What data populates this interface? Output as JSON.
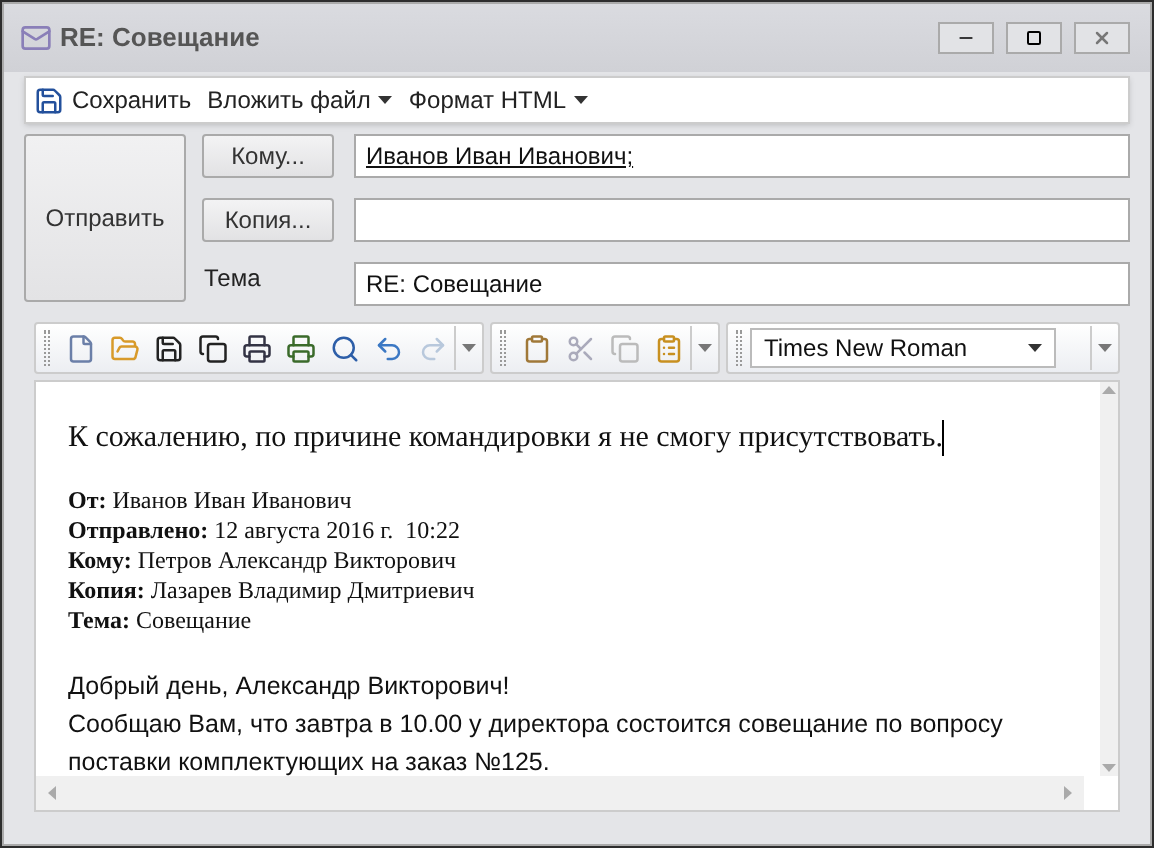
{
  "window": {
    "title": "RE: Совещание"
  },
  "menu": [
    {
      "label": "Сохранить",
      "kind": "save"
    },
    {
      "label": "Вложить файл",
      "kind": "dropdown"
    },
    {
      "label": "Формат HTML",
      "kind": "dropdown"
    }
  ],
  "send_button": "Отправить",
  "fields": [
    {
      "kind": "button",
      "label": "Кому...",
      "value": "Иванов Иван Иванович;"
    },
    {
      "kind": "button",
      "label": "Копия..."
    },
    {
      "kind": "label",
      "label": "Тема",
      "value": "RE: Совещание"
    }
  ],
  "font_select": {
    "value": "Times New Roman"
  },
  "editor": {
    "reply": "К сожалению, по причине командировки я не смогу присутствовать.",
    "quote_header": [
      "**От:** Иванов Иван Иванович",
      "**Отправлено:** 12 августа 2016 г.  10:22",
      "**Кому:** Петров Александр Викторович",
      "**Копия:** Лазарев Владимир Дмитриевич",
      "**Тема:** Совещание"
    ],
    "body": [
      "Добрый день, Александр Викторович!",
      "Сообщаю Вам, что завтра в 10.00 у директора состоится совещание по вопросу поставки комплектующих на заказ №125."
    ]
  }
}
